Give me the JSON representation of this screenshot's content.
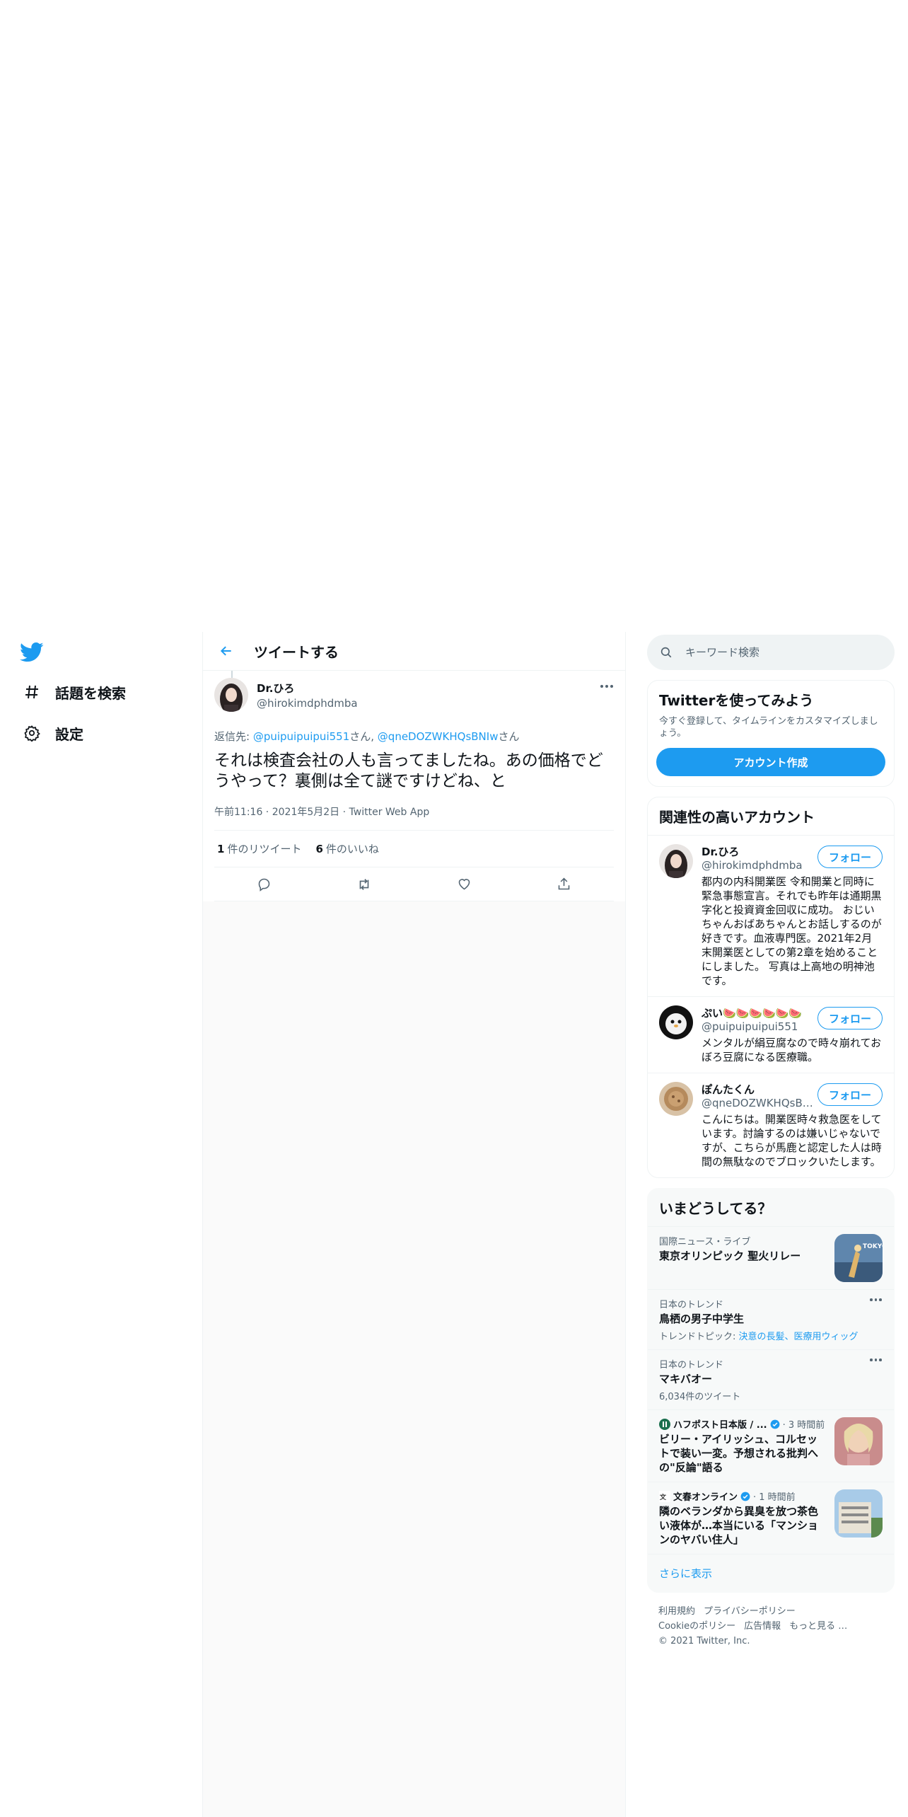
{
  "nav": {
    "explore_label": "話題を検索",
    "settings_label": "設定"
  },
  "header": {
    "title": "ツイートする"
  },
  "tweet": {
    "author_name": "Dr.ひろ",
    "author_handle": "@hirokimdphdmba",
    "reply_prefix": "返信先: ",
    "reply_user1": "@puipuipuipui551",
    "reply_sep1": "さん, ",
    "reply_user2": "@qneDOZWKHQsBNIw",
    "reply_sep2": "さん",
    "text": "それは検査会社の人も言ってましたね。あの価格でどうやって？裏側は全て謎ですけどね、と",
    "time": "午前11:16",
    "date": "2021年5月2日",
    "client": "Twitter Web App",
    "meta_sep": " · ",
    "retweet_count": "1",
    "retweet_label": "件のリツイート",
    "like_count": "6",
    "like_label": "件のいいね"
  },
  "search": {
    "placeholder": "キーワード検索"
  },
  "try_card": {
    "title": "Twitterを使ってみよう",
    "subtitle": "今すぐ登録して、タイムラインをカスタマイズしましょう。",
    "button": "アカウント作成"
  },
  "related": {
    "title": "関連性の高いアカウント",
    "follow_label": "フォロー",
    "accounts": [
      {
        "name": "Dr.ひろ",
        "handle": "@hirokimdphdmba",
        "bio": "都内の内科開業医 令和開業と同時に緊急事態宣言。それでも昨年は通期黒字化と投資資金回収に成功。 おじいちゃんおばあちゃんとお話しするのが好きです。血液専門医。2021年2月末開業医としての第2章を始めることにしました。 写真は上高地の明神池です。"
      },
      {
        "name": "ぷい🍉🍉🍉🍉🍉🍉",
        "handle": "@puipuipuipui551",
        "bio": "メンタルが絹豆腐なので時々崩れておぼろ豆腐になる医療職。"
      },
      {
        "name": "ぽんたくん",
        "handle": "@qneDOZWKHQsBNIw",
        "bio": "こんにちは。開業医時々救急医をしています。討論するのは嫌いじゃないですが、こちらが馬鹿と認定した人は時間の無駄なのでブロックいたします。"
      }
    ]
  },
  "trends": {
    "title": "いまどうしてる？",
    "items": [
      {
        "context": "国際ニュース・ライブ",
        "title": "東京オリンピック 聖火リレー"
      },
      {
        "context": "日本のトレンド",
        "title": "鳥栖の男子中学生",
        "sub_prefix": "トレンドトピック: ",
        "sub_links": "決意の長髪、医療用ウィッグ"
      },
      {
        "context": "日本のトレンド",
        "title": "マキバオー",
        "sub": "6,034件のツイート"
      },
      {
        "source": "ハフポスト日本版 / ...",
        "time": "· 3 時間前",
        "title": "ビリー・アイリッシュ、コルセットで装い一変。予想される批判への\"反論\"語る"
      },
      {
        "source": "文春オンライン",
        "time": "· 1 時間前",
        "title": "隣のベランダから異臭を放つ茶色い液体が…本当にいる「マンションのヤバい住人」"
      }
    ],
    "show_more": "さらに表示"
  },
  "footer": {
    "links_row1": [
      "利用規約",
      "プライバシーポリシー"
    ],
    "links_row2": [
      "Cookieのポリシー",
      "広告情報",
      "もっと見る …"
    ],
    "copyright": "© 2021 Twitter, Inc."
  },
  "colors": {
    "accent": "#1d9bf0",
    "text": "#0f1419",
    "secondary": "#536471"
  }
}
